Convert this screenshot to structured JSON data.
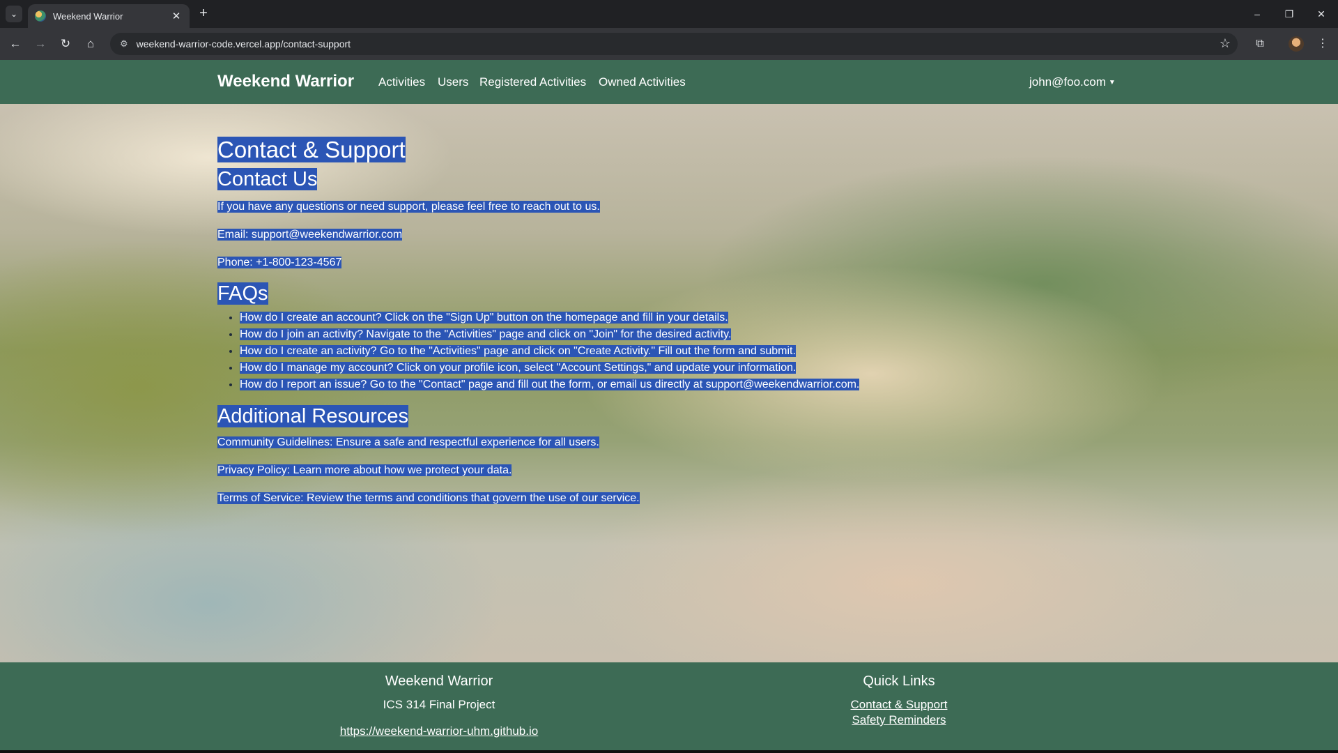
{
  "browser": {
    "tab_title": "Weekend Warrior",
    "url": "weekend-warrior-code.vercel.app/contact-support",
    "window_controls": [
      "–",
      "❐",
      "✕"
    ]
  },
  "navbar": {
    "brand": "Weekend Warrior",
    "links": [
      "Activities",
      "Users",
      "Registered Activities",
      "Owned Activities"
    ],
    "user": "john@foo.com"
  },
  "main": {
    "title": "Contact & Support",
    "contact": {
      "heading": "Contact Us",
      "intro": "If you have any questions or need support, please feel free to reach out to us.",
      "email": "Email: support@weekendwarrior.com",
      "phone": "Phone: +1-800-123-4567"
    },
    "faqs": {
      "heading": "FAQs",
      "items": [
        "How do I create an account? Click on the \"Sign Up\" button on the homepage and fill in your details.",
        "How do I join an activity? Navigate to the \"Activities\" page and click on \"Join\" for the desired activity.",
        "How do I create an activity? Go to the \"Activities\" page and click on \"Create Activity.\" Fill out the form and submit.",
        "How do I manage my account? Click on your profile icon, select \"Account Settings,\" and update your information.",
        "How do I report an issue? Go to the \"Contact\" page and fill out the form, or email us directly at support@weekendwarrior.com."
      ]
    },
    "resources": {
      "heading": "Additional Resources",
      "items": [
        "Community Guidelines: Ensure a safe and respectful experience for all users.",
        "Privacy Policy: Learn more about how we protect your data.",
        "Terms of Service: Review the terms and conditions that govern the use of our service."
      ]
    }
  },
  "footer": {
    "brand_title": "Weekend Warrior",
    "subtitle": "ICS 314 Final Project",
    "site_link": "https://weekend-warrior-uhm.github.io",
    "quick_links_title": "Quick Links",
    "quick_links": [
      "Contact & Support",
      "Safety Reminders"
    ]
  },
  "colors": {
    "navbar": "#3d6b55",
    "selection": "#2b55b5"
  }
}
